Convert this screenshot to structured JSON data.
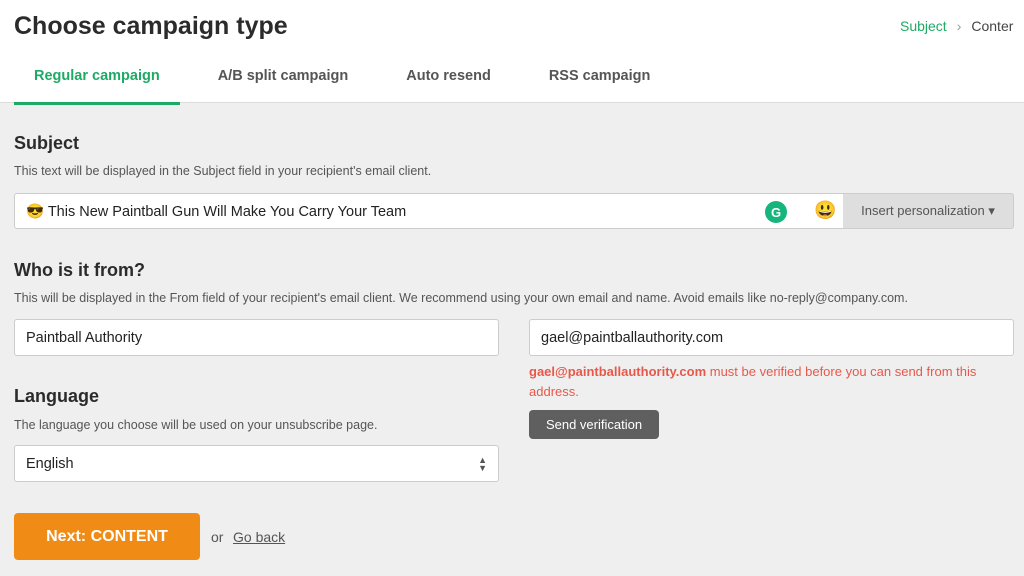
{
  "header": {
    "title": "Choose campaign type",
    "steps": [
      "Subject",
      "Conter"
    ]
  },
  "tabs": [
    {
      "label": "Regular campaign",
      "active": true
    },
    {
      "label": "A/B split campaign"
    },
    {
      "label": "Auto resend"
    },
    {
      "label": "RSS campaign"
    }
  ],
  "subject": {
    "heading": "Subject",
    "help": "This text will be displayed in the Subject field in your recipient's email client.",
    "value": "😎 This New Paintball Gun Will Make You Carry Your Team",
    "personalize": "Insert personalization ▾"
  },
  "from": {
    "heading": "Who is it from?",
    "help": "This will be displayed in the From field of your recipient's email client. We recommend using your own email and name. Avoid emails like no-reply@company.com.",
    "name": "Paintball Authority",
    "email": "gael@paintballauthority.com",
    "error_email": "gael@paintballauthority.com",
    "error_text": " must be verified before you can send from this address.",
    "verify": "Send verification"
  },
  "language": {
    "heading": "Language",
    "help": "The language you choose will be used on your unsubscribe page.",
    "value": "English"
  },
  "actions": {
    "next": "Next: CONTENT",
    "or": "or",
    "back": "Go back"
  },
  "colors": {
    "accent": "#1eaa64",
    "primary_button": "#f08c16",
    "error": "#e8584a"
  }
}
